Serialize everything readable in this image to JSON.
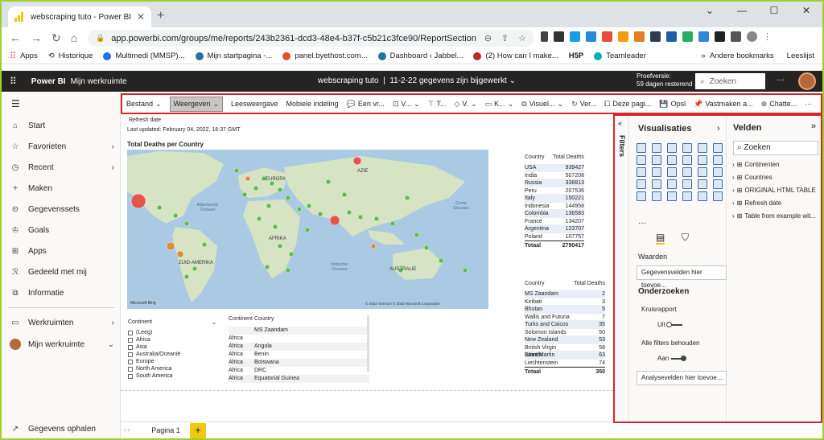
{
  "browser": {
    "tab_title": "webscraping tuto - Power BI",
    "url": "app.powerbi.com/groups/me/reports/243b2361-dcd3-48e4-b37f-c5b21c3fce90/ReportSection"
  },
  "bookmarks": {
    "items": [
      "Apps",
      "Historique",
      "Multimedi (MMSP)...",
      "Mijn startpagina -...",
      "panel.byethost.com...",
      "Dashboard ‹ Jabbel...",
      "(2) How can I make...",
      "H5P",
      "Teamleader"
    ],
    "right": [
      "Andere bookmarks",
      "Leeslijst"
    ]
  },
  "pbi": {
    "brand": "Power BI",
    "workspace": "Mijn werkruimte",
    "report": "webscraping tuto",
    "status": "11-2-22 gegevens zijn bijgewerkt",
    "trial_line1": "Proefversie:",
    "trial_line2": "59 dagen resterend",
    "search_placeholder": "Zoeken"
  },
  "nav": {
    "items": [
      {
        "icon": "home-icon",
        "label": "Start"
      },
      {
        "icon": "star-icon",
        "label": "Favorieten"
      },
      {
        "icon": "clock-icon",
        "label": "Recent"
      },
      {
        "icon": "plus-icon",
        "label": "Maken"
      },
      {
        "icon": "cylinder-icon",
        "label": "Gegevenssets"
      },
      {
        "icon": "trophy-icon",
        "label": "Goals"
      },
      {
        "icon": "apps-icon",
        "label": "Apps"
      },
      {
        "icon": "share-icon",
        "label": "Gedeeld met mij"
      },
      {
        "icon": "book-icon",
        "label": "Informatie"
      },
      {
        "icon": "workspace-icon",
        "label": "Werkruimten"
      },
      {
        "icon": "avatar",
        "label": "Mijn werkruimte"
      }
    ],
    "get_data": "Gegevens ophalen"
  },
  "ribbon": {
    "items": [
      "Bestand",
      "Weergeven",
      "Leesweergave",
      "Mobiele indeling",
      "Een vr...",
      "V...",
      "T...",
      "V.",
      "K...",
      "Visuel...",
      "Ver...",
      "Deze pagi...",
      "Opsl",
      "Vastmaken a...",
      "Chatte..."
    ]
  },
  "report": {
    "refresh": "Refresh date",
    "last_updated": "Last updated: February 04, 2022, 16:37 GMT",
    "map_title": "Total Deaths per Country"
  },
  "table1": {
    "headers": [
      "Country",
      "Total Deaths"
    ],
    "rows": [
      [
        "USA",
        "939427"
      ],
      [
        "India",
        "507208"
      ],
      [
        "Russia",
        "338813"
      ],
      [
        "Peru",
        "207536"
      ],
      [
        "Italy",
        "150221"
      ],
      [
        "Indonesia",
        "144958"
      ],
      [
        "Colombia",
        "136583"
      ],
      [
        "France",
        "134207"
      ],
      [
        "Argentina",
        "123707"
      ],
      [
        "Poland",
        "107757"
      ]
    ],
    "total": [
      "Totaal",
      "2790417"
    ]
  },
  "table2": {
    "headers": [
      "Country",
      "Total Deaths"
    ],
    "rows": [
      [
        "MS Zaandam",
        "2"
      ],
      [
        "Kiribati",
        "3"
      ],
      [
        "Bhutan",
        "5"
      ],
      [
        "Wallis and Futuna",
        "7"
      ],
      [
        "Turks and Caicos",
        "35"
      ],
      [
        "Solomon Islands",
        "50"
      ],
      [
        "New Zealand",
        "53"
      ],
      [
        "British Virgin Islands",
        "58"
      ],
      [
        "Saint Martin",
        "63"
      ],
      [
        "Liechtenstein",
        "74"
      ]
    ],
    "total": [
      "Totaal",
      "350"
    ]
  },
  "slicer": {
    "title": "Continent",
    "options": [
      "(Leeg)",
      "Africa",
      "Asia",
      "Australia/Oceanië",
      "Europe",
      "North America",
      "South America"
    ]
  },
  "cont_table": {
    "headers": [
      "Continent",
      "Country"
    ],
    "rows": [
      [
        "",
        "MS Zaandam"
      ],
      [
        "Africa",
        ""
      ],
      [
        "Africa",
        "Angola"
      ],
      [
        "Africa",
        "Benin"
      ],
      [
        "Africa",
        "Botswana"
      ],
      [
        "Africa",
        "DRC"
      ],
      [
        "Africa",
        "Equatorial Guinea"
      ]
    ]
  },
  "map": {
    "labels": [
      "EUROPA",
      "AZIE",
      "Atlantische Oceaan",
      "AFRIKA",
      "ZUID-AMERIKA",
      "Indische Oceaan",
      "AUSTRALIE",
      "Grote Oceaan"
    ],
    "copyright": "© 2022 TomTom © 2022 Microsoft Corporation",
    "logo": "Microsoft Bing"
  },
  "page": {
    "tab": "Pagina 1"
  },
  "panes": {
    "filters": "Filters",
    "vis_title": "Visualisaties",
    "values_label": "Waarden",
    "values_box": "Gegevensvelden hier toevoe...",
    "drill": "Onderzoeken",
    "cross": "Kruisrapport",
    "cross_state": "Uit",
    "keep_filters": "Alle filters behouden",
    "keep_state": "Aan",
    "drill_box": "Analysevelden hier toevoe...",
    "fields_title": "Velden",
    "fields_search": "Zoeken",
    "fields": [
      "Continenten",
      "Countries",
      "ORIGINAL HTML TABLE",
      "Refresh date",
      "Table from example wit..."
    ]
  }
}
